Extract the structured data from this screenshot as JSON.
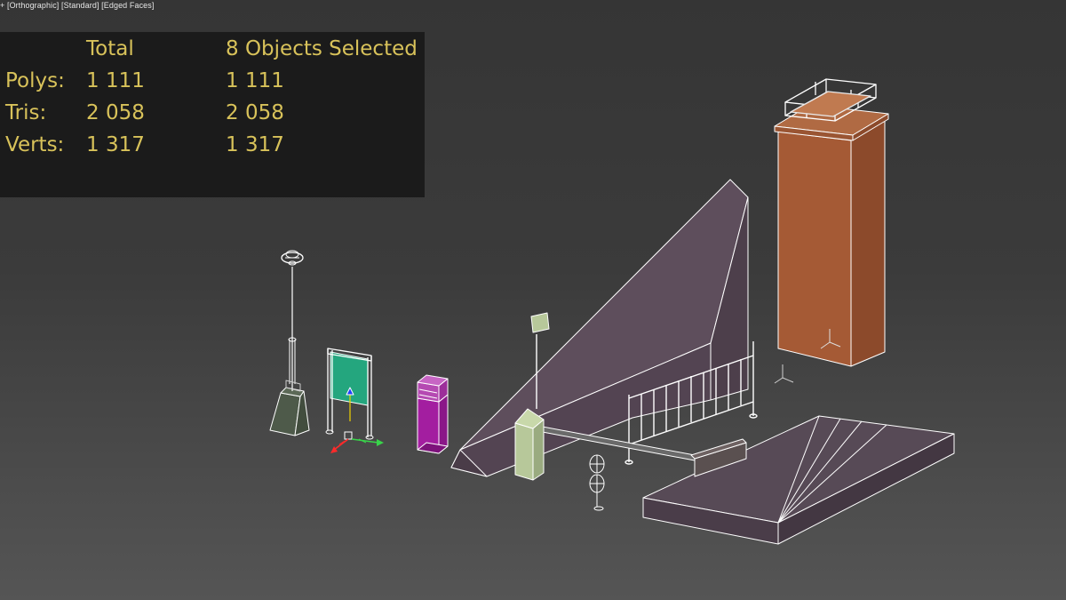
{
  "viewport": {
    "menu": "+",
    "view": "[Orthographic]",
    "shading": "[Standard]",
    "display": "[Edged Faces]"
  },
  "stats": {
    "col_total": "Total",
    "col_selected": "8 Objects Selected",
    "rows": [
      {
        "label": "Polys:",
        "total": "1 111",
        "selected": "1 111"
      },
      {
        "label": "Tris:",
        "total": "2 058",
        "selected": "2 058"
      },
      {
        "label": "Verts:",
        "total": "1 317",
        "selected": "1 317"
      }
    ]
  },
  "colors": {
    "background_top": "#353535",
    "background_bottom": "#555555",
    "stats_text": "#d8c25a",
    "wire": "#ffffff",
    "ramp": "#5e4e5c",
    "pad": "#574a56",
    "tower": "#a55a35",
    "sign_panel": "#24a67e",
    "vending": "#a31ea0",
    "gate_box": "#b7c89a",
    "lamp_base": "#4e5a4a",
    "fence": "#ffffff"
  },
  "scene_objects": [
    "street-lamp",
    "info-sign",
    "vending-machine",
    "ramp",
    "barrier-gate",
    "fence",
    "stairs-pad",
    "tower"
  ]
}
